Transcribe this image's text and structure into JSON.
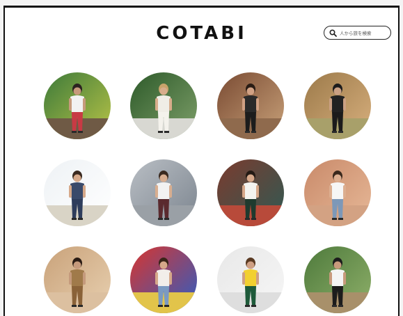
{
  "site": {
    "logo": "COTABI"
  },
  "search": {
    "placeholder": "人から旅を検索",
    "icon": "search-icon"
  },
  "photos": [
    {
      "bg1": "#3d7a3a",
      "bg2": "#b9c447",
      "floor": "#6f5a45",
      "shirt": "#f2f2f2",
      "pants": "#c83a44",
      "skin": "#c79a7c",
      "hair": "#2b2220"
    },
    {
      "bg1": "#2d5a2a",
      "bg2": "#7fa06a",
      "floor": "#d8d8d2",
      "shirt": "#f0ede6",
      "pants": "#f4f2ec",
      "skin": "#d8ad8c",
      "hair": "#c9a36b"
    },
    {
      "bg1": "#7a4b33",
      "bg2": "#c9a27a",
      "floor": "#8f6a4d",
      "shirt": "#2a2a2a",
      "pants": "#1c1c1c",
      "skin": "#d1a184",
      "hair": "#2a1c14"
    },
    {
      "bg1": "#9c7a4a",
      "bg2": "#d8b07e",
      "floor": "#a8a06a",
      "shirt": "#222222",
      "pants": "#1b1b1b",
      "skin": "#caa083",
      "hair": "#1c1c1c"
    },
    {
      "bg1": "#eef2f5",
      "bg2": "#ffffff",
      "floor": "#d9d4c6",
      "shirt": "#3a4a6a",
      "pants": "#2e3d5c",
      "skin": "#d6a98a",
      "hair": "#3a2a20"
    },
    {
      "bg1": "#b9bec4",
      "bg2": "#7c858f",
      "floor": "#9aa0a6",
      "shirt": "#f2f2f2",
      "pants": "#5a2a2e",
      "skin": "#d8ae90",
      "hair": "#3a2a20"
    },
    {
      "bg1": "#7b3b2e",
      "bg2": "#2f5a54",
      "floor": "#b84a3a",
      "shirt": "#f4f4f0",
      "pants": "#1f3a2e",
      "skin": "#d6a88a",
      "hair": "#241a14"
    },
    {
      "bg1": "#c98a6a",
      "bg2": "#e7b998",
      "floor": "#d3a283",
      "shirt": "#f6f6f6",
      "pants": "#7d98b8",
      "skin": "#dcae90",
      "hair": "#3a281c"
    },
    {
      "bg1": "#c9a27a",
      "bg2": "#e8d0b0",
      "floor": "#dcc0a0",
      "shirt": "#a07a4a",
      "pants": "#8a6238",
      "skin": "#c59a7c",
      "hair": "#2a1c14"
    },
    {
      "bg1": "#d8352e",
      "bg2": "#2d5ec4",
      "floor": "#e2c44a",
      "shirt": "#f2eeea",
      "pants": "#7b9ac2",
      "skin": "#d6a88a",
      "hair": "#3a2418"
    },
    {
      "bg1": "#e8e8e8",
      "bg2": "#f6f6f6",
      "floor": "#dedede",
      "shirt": "#f2d030",
      "pants": "#1e5a3a",
      "skin": "#cfa084",
      "hair": "#5a3a22"
    },
    {
      "bg1": "#4e7a3c",
      "bg2": "#8fb06a",
      "floor": "#a8906a",
      "shirt": "#f4f4f4",
      "pants": "#1c1c1c",
      "skin": "#c89a7c",
      "hair": "#1c1c1c"
    }
  ]
}
